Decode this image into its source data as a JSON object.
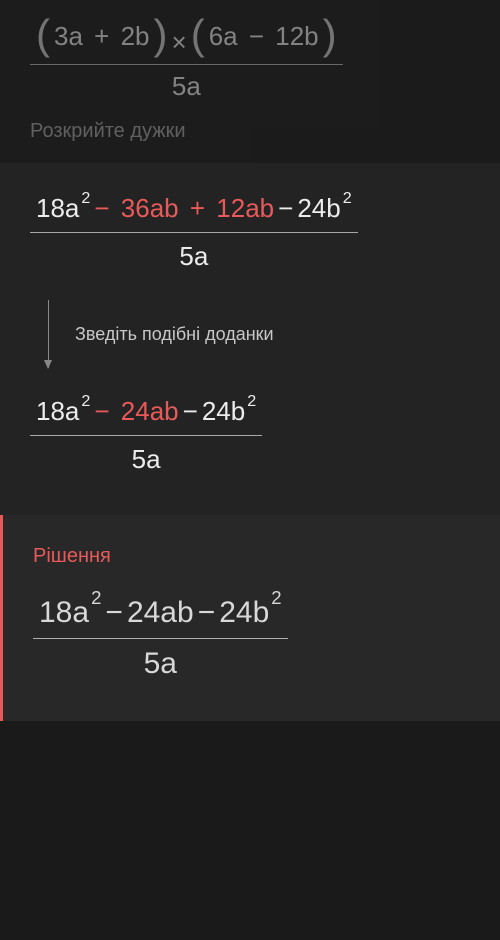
{
  "step0": {
    "instruction": "Розкрийте дужки",
    "expr": {
      "p1_t1": "3a",
      "p1_op": "+",
      "p1_t2": "2b",
      "mult": "×",
      "p2_t1": "6a",
      "p2_op": "−",
      "p2_t2": "12b",
      "den": "5a"
    }
  },
  "step1": {
    "expr1": {
      "t1_coef": "18a",
      "t1_exp": "2",
      "t2_op": "−",
      "t2": "36ab",
      "t3_op": "+",
      "t3": "12ab",
      "t4_op": "−",
      "t4_coef": "24b",
      "t4_exp": "2",
      "den": "5a"
    },
    "arrow_label": "Зведіть подібні доданки",
    "expr2": {
      "t1_coef": "18a",
      "t1_exp": "2",
      "t2_op": "−",
      "t2": "24ab",
      "t3_op": "−",
      "t3_coef": "24b",
      "t3_exp": "2",
      "den": "5a"
    }
  },
  "solution": {
    "title": "Рішення",
    "expr": {
      "t1_coef": "18a",
      "t1_exp": "2",
      "t2_op": "−",
      "t2": "24ab",
      "t3_op": "−",
      "t3_coef": "24b",
      "t3_exp": "2",
      "den": "5a"
    }
  }
}
